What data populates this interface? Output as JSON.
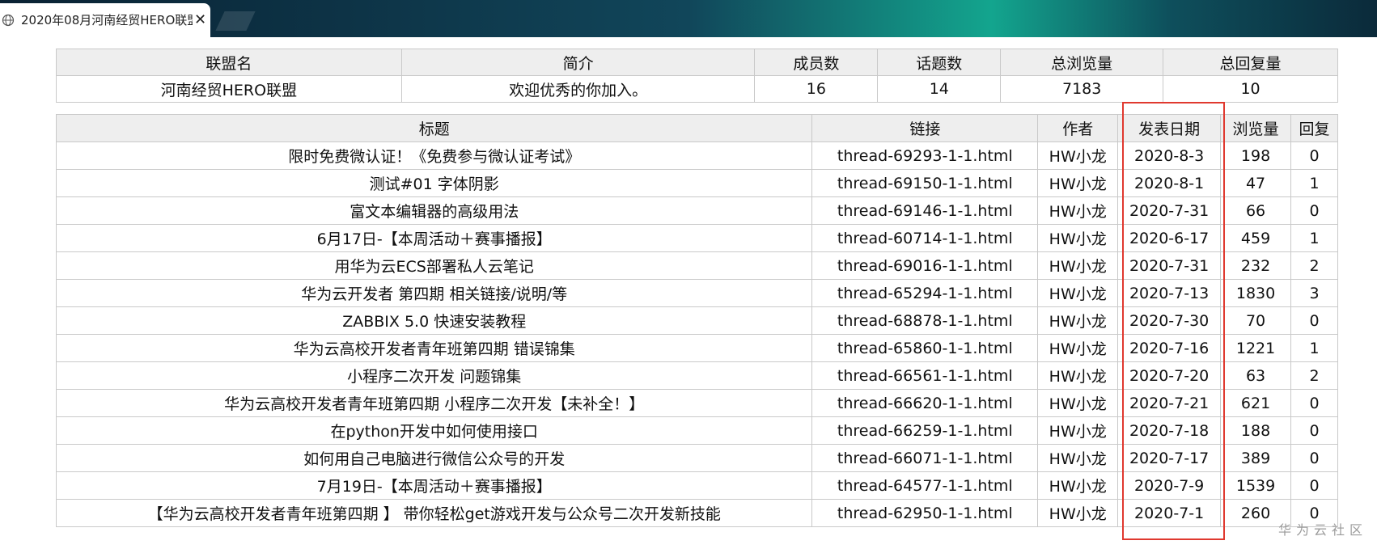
{
  "browser": {
    "tab_title": "2020年08月河南经贸HERO联盟",
    "tab_icon": "globe-icon",
    "close_glyph": "✕"
  },
  "league": {
    "headers": [
      "联盟名",
      "简介",
      "成员数",
      "话题数",
      "总浏览量",
      "总回复量"
    ],
    "row": [
      "河南经贸HERO联盟",
      "欢迎优秀的你加入。",
      "16",
      "14",
      "7183",
      "10"
    ]
  },
  "threads": {
    "headers": [
      "标题",
      "链接",
      "作者",
      "发表日期",
      "浏览量",
      "回复"
    ],
    "rows": [
      [
        "限时免费微认证！《免费参与微认证考试》",
        "thread-69293-1-1.html",
        "HW小龙",
        "2020-8-3",
        "198",
        "0"
      ],
      [
        "测试#01 字体阴影",
        "thread-69150-1-1.html",
        "HW小龙",
        "2020-8-1",
        "47",
        "1"
      ],
      [
        "富文本编辑器的高级用法",
        "thread-69146-1-1.html",
        "HW小龙",
        "2020-7-31",
        "66",
        "0"
      ],
      [
        "6月17日-【本周活动＋赛事播报】",
        "thread-60714-1-1.html",
        "HW小龙",
        "2020-6-17",
        "459",
        "1"
      ],
      [
        "用华为云ECS部署私人云笔记",
        "thread-69016-1-1.html",
        "HW小龙",
        "2020-7-31",
        "232",
        "2"
      ],
      [
        "华为云开发者 第四期 相关链接/说明/等",
        "thread-65294-1-1.html",
        "HW小龙",
        "2020-7-13",
        "1830",
        "3"
      ],
      [
        "ZABBIX 5.0 快速安装教程",
        "thread-68878-1-1.html",
        "HW小龙",
        "2020-7-30",
        "70",
        "0"
      ],
      [
        "华为云高校开发者青年班第四期 错误锦集",
        "thread-65860-1-1.html",
        "HW小龙",
        "2020-7-16",
        "1221",
        "1"
      ],
      [
        "小程序二次开发 问题锦集",
        "thread-66561-1-1.html",
        "HW小龙",
        "2020-7-20",
        "63",
        "2"
      ],
      [
        "华为云高校开发者青年班第四期 小程序二次开发【未补全！】",
        "thread-66620-1-1.html",
        "HW小龙",
        "2020-7-21",
        "621",
        "0"
      ],
      [
        "在python开发中如何使用接口",
        "thread-66259-1-1.html",
        "HW小龙",
        "2020-7-18",
        "188",
        "0"
      ],
      [
        "如何用自己电脑进行微信公众号的开发",
        "thread-66071-1-1.html",
        "HW小龙",
        "2020-7-17",
        "389",
        "0"
      ],
      [
        "7月19日-【本周活动＋赛事播报】",
        "thread-64577-1-1.html",
        "HW小龙",
        "2020-7-9",
        "1539",
        "0"
      ],
      [
        "【华为云高校开发者青年班第四期 】 带你轻松get游戏开发与公众号二次开发新技能",
        "thread-62950-1-1.html",
        "HW小龙",
        "2020-7-1",
        "260",
        "0"
      ]
    ]
  },
  "highlight_color": "#e0392f",
  "watermark": "华为云社区"
}
